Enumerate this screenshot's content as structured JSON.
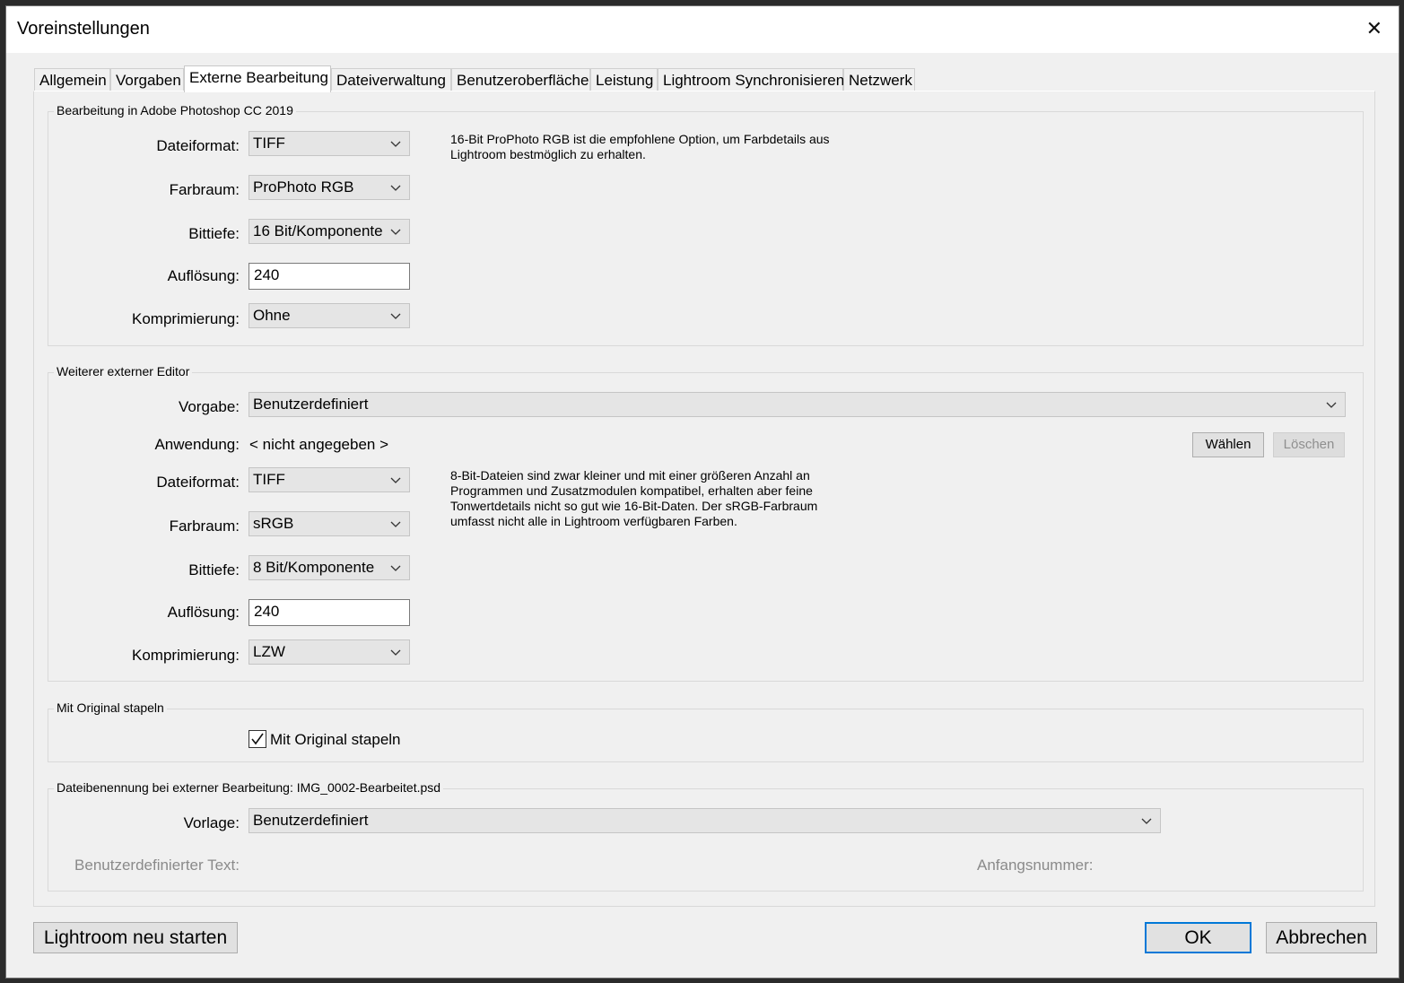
{
  "window": {
    "title": "Voreinstellungen",
    "close_glyph": "✕"
  },
  "tabs": [
    {
      "label": "Allgemein"
    },
    {
      "label": "Vorgaben"
    },
    {
      "label": "Externe Bearbeitung",
      "active": true
    },
    {
      "label": "Dateiverwaltung"
    },
    {
      "label": "Benutzeroberfläche"
    },
    {
      "label": "Leistung"
    },
    {
      "label": "Lightroom Synchronisieren"
    },
    {
      "label": "Netzwerk"
    }
  ],
  "photoshop": {
    "legend": "Bearbeitung in Adobe Photoshop CC 2019",
    "dateiformat_label": "Dateiformat:",
    "dateiformat_value": "TIFF",
    "farbraum_label": "Farbraum:",
    "farbraum_value": "ProPhoto RGB",
    "bittiefe_label": "Bittiefe:",
    "bittiefe_value": "16 Bit/Komponente",
    "aufloesung_label": "Auflösung:",
    "aufloesung_value": "240",
    "komprimierung_label": "Komprimierung:",
    "komprimierung_value": "Ohne",
    "note": "16-Bit ProPhoto RGB ist die empfohlene Option, um Farbdetails aus\nLightroom bestmöglich zu erhalten."
  },
  "extern": {
    "legend": "Weiterer externer Editor",
    "vorgabe_label": "Vorgabe:",
    "vorgabe_value": "Benutzerdefiniert",
    "anwendung_label": "Anwendung:",
    "anwendung_value": "< nicht angegeben >",
    "waehlen_label": "Wählen",
    "loeschen_label": "Löschen",
    "dateiformat_label": "Dateiformat:",
    "dateiformat_value": "TIFF",
    "farbraum_label": "Farbraum:",
    "farbraum_value": "sRGB",
    "bittiefe_label": "Bittiefe:",
    "bittiefe_value": "8 Bit/Komponente",
    "aufloesung_label": "Auflösung:",
    "aufloesung_value": "240",
    "komprimierung_label": "Komprimierung:",
    "komprimierung_value": "LZW",
    "note": "8-Bit-Dateien sind zwar kleiner und mit einer größeren Anzahl an\nProgrammen und Zusatzmodulen kompatibel, erhalten aber feine\nTonwertdetails nicht so gut wie 16-Bit-Daten. Der sRGB-Farbraum\numfasst nicht alle in Lightroom verfügbaren Farben."
  },
  "stapeln": {
    "legend": "Mit Original stapeln",
    "checkbox_label": "Mit Original stapeln",
    "checked": true
  },
  "benennung": {
    "legend": "Dateibenennung bei externer Bearbeitung: IMG_0002-Bearbeitet.psd",
    "vorlage_label": "Vorlage:",
    "vorlage_value": "Benutzerdefiniert",
    "custom_text_label": "Benutzerdefinierter Text:",
    "start_number_label": "Anfangsnummer:"
  },
  "footer": {
    "restart_label": "Lightroom neu starten",
    "ok_label": "OK",
    "cancel_label": "Abbrechen"
  },
  "colors": {
    "focus_blue": "#0078d7",
    "dialog_bg": "#f0f0f0"
  }
}
